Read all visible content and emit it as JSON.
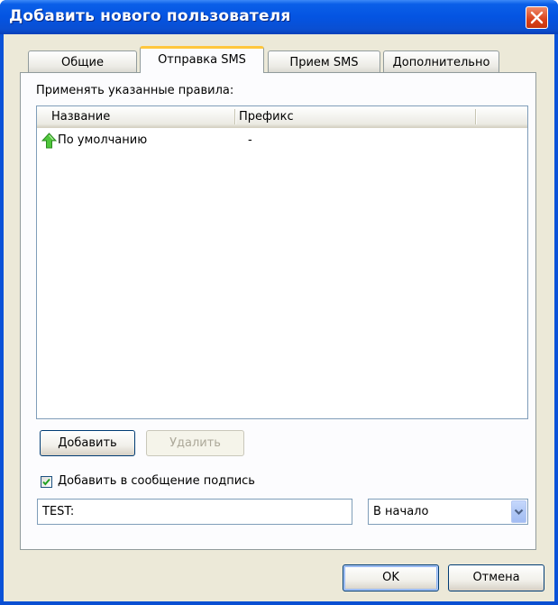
{
  "window": {
    "title": "Добавить нового пользователя"
  },
  "tabs": [
    {
      "label": "Общие",
      "active": false
    },
    {
      "label": "Отправка SMS",
      "active": true
    },
    {
      "label": "Прием SMS",
      "active": false
    },
    {
      "label": "Дополнительно",
      "active": false
    }
  ],
  "rules": {
    "caption": "Применять указанные правила:",
    "columns": [
      "Название",
      "Префикс"
    ],
    "rows": [
      {
        "name": "По умолчанию",
        "prefix": "-",
        "icon": "green-up-arrow-icon"
      }
    ]
  },
  "buttons": {
    "add": "Добавить",
    "delete": "Удалить",
    "ok": "OK",
    "cancel": "Отмена"
  },
  "signature": {
    "checkbox_label": "Добавить в сообщение подпись",
    "checked": true,
    "text": "TEST:",
    "position": "В начало"
  },
  "colors": {
    "titlebar": "#0454e2",
    "dialog": "#ece9d8",
    "close": "#d9421a",
    "tab_highlight": "#ffc73c"
  }
}
